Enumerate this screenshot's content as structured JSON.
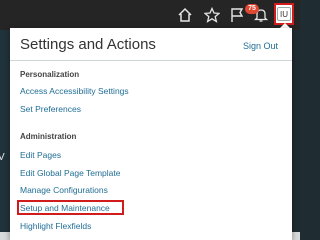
{
  "header": {
    "icons": [
      "home-icon",
      "star-icon",
      "flag-icon",
      "bell-icon"
    ],
    "notification_count": "75",
    "user_initials": "IU"
  },
  "background": {
    "left_text": "V"
  },
  "menu": {
    "title": "Settings and Actions",
    "sign_out": "Sign Out",
    "sections": [
      {
        "heading": "Personalization",
        "items": [
          "Access Accessibility Settings",
          "Set Preferences"
        ]
      },
      {
        "heading": "Administration",
        "items": [
          "Edit Pages",
          "Edit Global Page Template",
          "Manage Configurations",
          "Setup and Maintenance",
          "Highlight Flexfields"
        ]
      }
    ],
    "highlighted_item": "Setup and Maintenance",
    "highlight_color": "#d01c1c"
  }
}
